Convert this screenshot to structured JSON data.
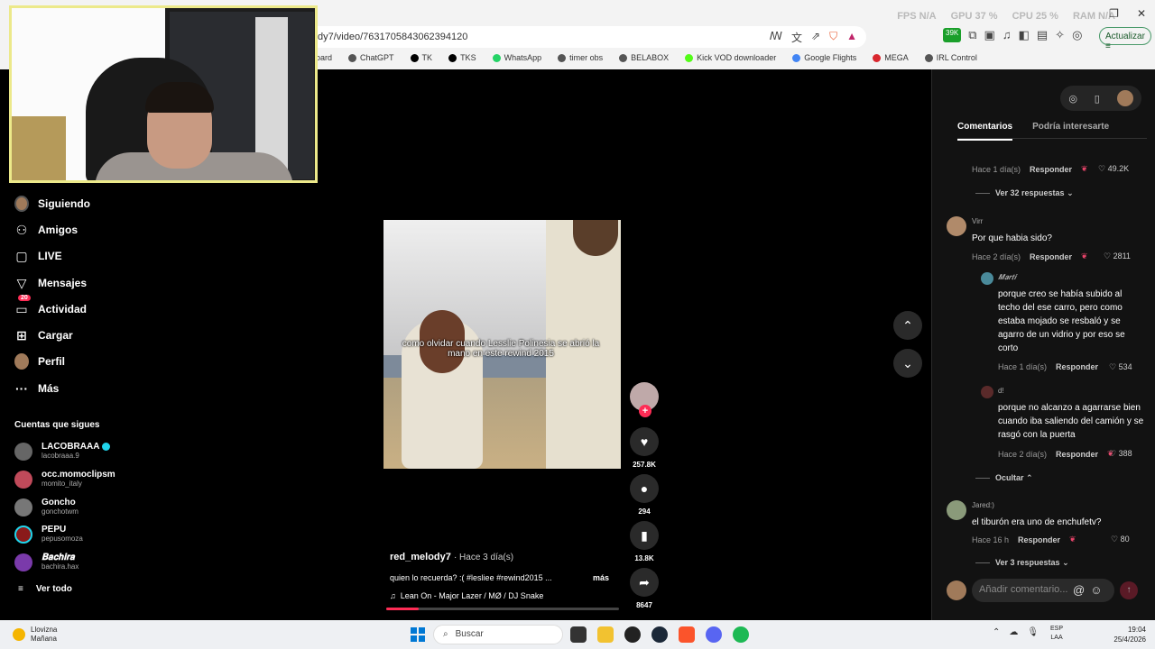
{
  "browser": {
    "url": "dy7/video/7631705843062394120",
    "stats": [
      "FPS N/A",
      "GPU 37 %",
      "CPU 25 %",
      "RAM N/A"
    ],
    "update_label": "Actualizar",
    "ext_badge": "39K",
    "bookmarks": [
      "hboard",
      "ChatGPT",
      "TK",
      "TKS",
      "WhatsApp",
      "timer obs",
      "BELABOX",
      "Kick VOD downloader",
      "Google Flights",
      "MEGA",
      "IRL Control"
    ]
  },
  "sidebar": {
    "items": [
      {
        "label": "Siguiendo",
        "icon": "following-avatar-icon"
      },
      {
        "label": "Amigos",
        "icon": "friends-icon"
      },
      {
        "label": "LIVE",
        "icon": "live-icon"
      },
      {
        "label": "Mensajes",
        "icon": "messages-icon"
      },
      {
        "label": "Actividad",
        "icon": "activity-icon",
        "badge": "20"
      },
      {
        "label": "Cargar",
        "icon": "upload-icon"
      },
      {
        "label": "Perfil",
        "icon": "profile-avatar-icon"
      },
      {
        "label": "Más",
        "icon": "more-icon"
      }
    ],
    "following_title": "Cuentas que sigues",
    "accounts": [
      {
        "name": "LACOBRAAA",
        "handle": "lacobraaa.9",
        "verified": true
      },
      {
        "name": "occ.momoclipsm",
        "handle": "momito_italy",
        "verified": false
      },
      {
        "name": "Goncho",
        "handle": "gonchotwm",
        "verified": false
      },
      {
        "name": "PEPU",
        "handle": "pepusomoza",
        "verified": false
      },
      {
        "name": "𝐁𝐚𝐜𝐡𝐢𝐫𝐚",
        "handle": "bachira.hax",
        "verified": false
      }
    ],
    "see_all": "Ver todo"
  },
  "video": {
    "caption": "como olvidar cuando Lesslie Polinesia se abrió la mano en este rewind 2015",
    "username": "red_melody7",
    "time": "· Hace 3 día(s)",
    "description": "quien lo recuerda? :( #lesliee #rewind2015 ...",
    "more": "más",
    "music": "Lean On - Major Lazer / MØ / DJ Snake",
    "progress": 0.14,
    "likes": "257.8K",
    "comments": "294",
    "saves": "13.8K",
    "shares": "8647"
  },
  "panel": {
    "tab_comments": "Comentarios",
    "tab_suggested": "Podría interesarte",
    "reply_label": "Responder",
    "comments": [
      {
        "meta_time": "Hace 1 día(s)",
        "likes": "49.2K",
        "view_replies": "Ver 32 respuestas"
      },
      {
        "user": "Virr",
        "text": "Por que habia sido?",
        "meta_time": "Hace 2 día(s)",
        "likes": "2811"
      },
      {
        "user": "𝑴𝒂𝒓𝒕𝒊",
        "text": "porque creo se había subido al techo del ese carro, pero como estaba mojado se resbaló y se agarro de un vidrio y por eso se corto",
        "meta_time": "Hace 1 día(s)",
        "likes": "534"
      },
      {
        "user": "d!",
        "text": "porque no alcanzo a agarrarse bien cuando iba saliendo del camión y se rasgó con la puerta",
        "meta_time": "Hace 2 día(s)",
        "likes": "388"
      },
      {
        "hide_label": "Ocultar"
      },
      {
        "user": "Jared:)",
        "text": "el tiburón era uno de enchufetv?",
        "meta_time": "Hace 16 h",
        "likes": "80",
        "view_replies": "Ver 3 respuestas"
      }
    ],
    "add_comment_placeholder": "Añadir comentario..."
  },
  "taskbar": {
    "weather_line1": "Llovizna",
    "weather_line2": "Mañana",
    "search_placeholder": "Buscar",
    "lang_line1": "ESP",
    "lang_line2": "LAA",
    "time": "19:04",
    "date": "25/4/2026"
  },
  "colors": {
    "accent": "#fe2c55",
    "panel_bg": "#121212",
    "webcam_border": "#ece98a"
  }
}
